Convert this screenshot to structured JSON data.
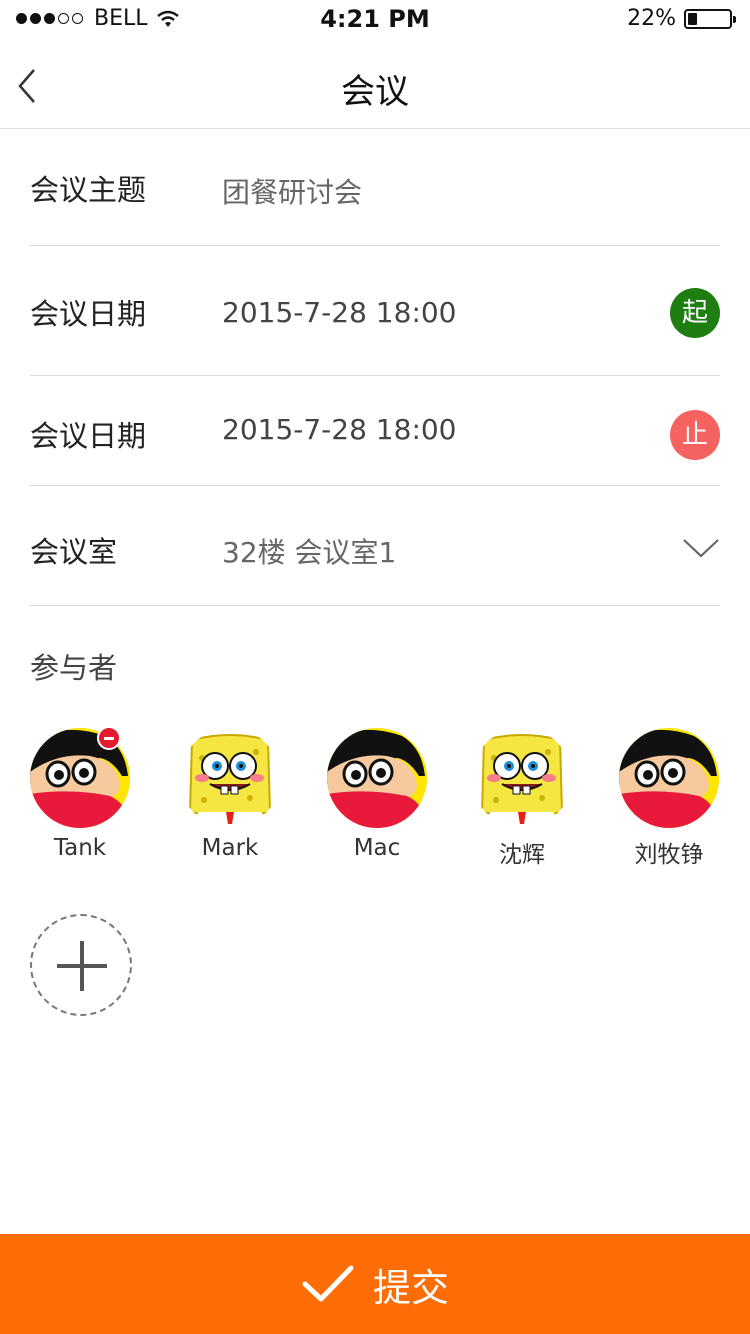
{
  "status_bar": {
    "carrier": "BELL",
    "time": "4:21 PM",
    "battery_percent": "22%",
    "battery_level": 0.22,
    "signal_bars": 3,
    "signal_total": 5
  },
  "nav": {
    "title": "会议",
    "back_icon": "chevron-left-icon"
  },
  "form": {
    "topic": {
      "label": "会议主题",
      "value": "团餐研讨会"
    },
    "start": {
      "label": "会议日期",
      "value": "2015-7-28  18:00",
      "badge": "起",
      "badge_color": "#1e7e12"
    },
    "end": {
      "label": "会议日期",
      "value": "2015-7-28  18:00",
      "badge": "止",
      "badge_color": "#f56360"
    },
    "room": {
      "label": "会议室",
      "value": "32楼 会议室1"
    }
  },
  "participants": {
    "title": "参与者",
    "items": [
      {
        "name": "Tank",
        "avatar": "crayon-shinchan-avatar",
        "removable": true
      },
      {
        "name": "Mark",
        "avatar": "spongebob-avatar",
        "removable": false
      },
      {
        "name": "Mac",
        "avatar": "crayon-shinchan-avatar",
        "removable": false
      },
      {
        "name": "沈辉",
        "avatar": "spongebob-avatar",
        "removable": false
      },
      {
        "name": "刘牧铮",
        "avatar": "crayon-shinchan-avatar",
        "removable": false
      }
    ]
  },
  "submit": {
    "label": "提交",
    "icon": "checkmark-icon",
    "color": "#fe6d05"
  }
}
